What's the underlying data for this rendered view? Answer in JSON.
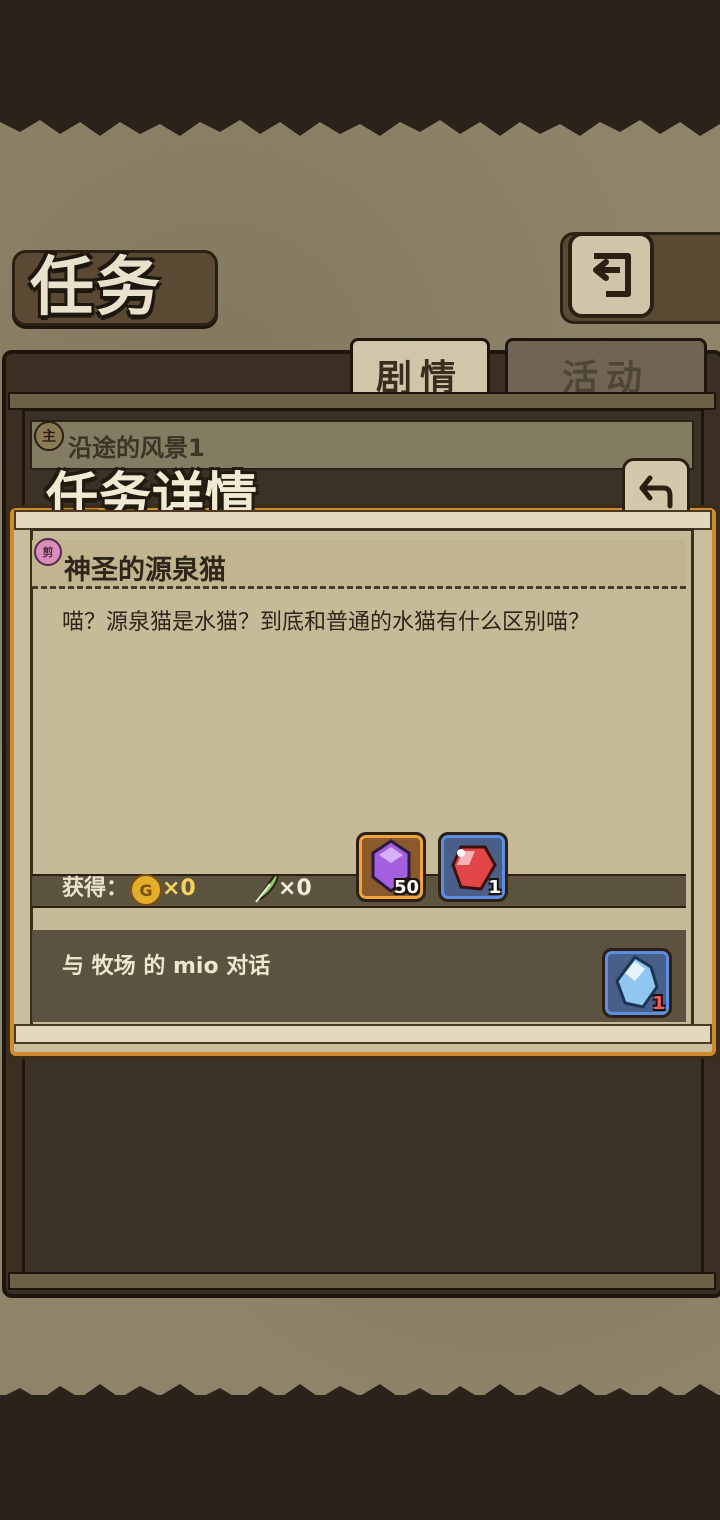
{
  "header": {
    "title": "任务",
    "back_icon": "return-arrow-icon"
  },
  "tabs": [
    {
      "label": "剧情",
      "active": true
    },
    {
      "label": "活动",
      "active": false
    }
  ],
  "quest_list": [
    {
      "icon_label": "主",
      "title": "沿途的风景1"
    }
  ],
  "detail": {
    "title": "任务详情",
    "back_icon": "return-arrow-icon",
    "quest_icon_label": "剪",
    "quest_name": "神圣的源泉猫",
    "description": "喵？源泉猫是水猫？到底和普通的水猫有什么区别喵？",
    "rewards": {
      "label": "获得：",
      "coin_icon_label": "G",
      "coin_count": "×0",
      "feather_count": "×0",
      "items": [
        {
          "icon": "purple-crystal-icon",
          "qty": "50",
          "frame": "#f0a43a"
        },
        {
          "icon": "red-gem-icon",
          "qty": "1",
          "frame": "#5b8ee0"
        }
      ]
    },
    "task": {
      "text": "与 牧场 的 mio 对话",
      "item": {
        "icon": "blue-crystal-icon",
        "qty": "1"
      }
    }
  },
  "colors": {
    "parchment": "#c6bb98",
    "popup_border": "#d08b2c",
    "dark_frame": "#3a2f22"
  }
}
